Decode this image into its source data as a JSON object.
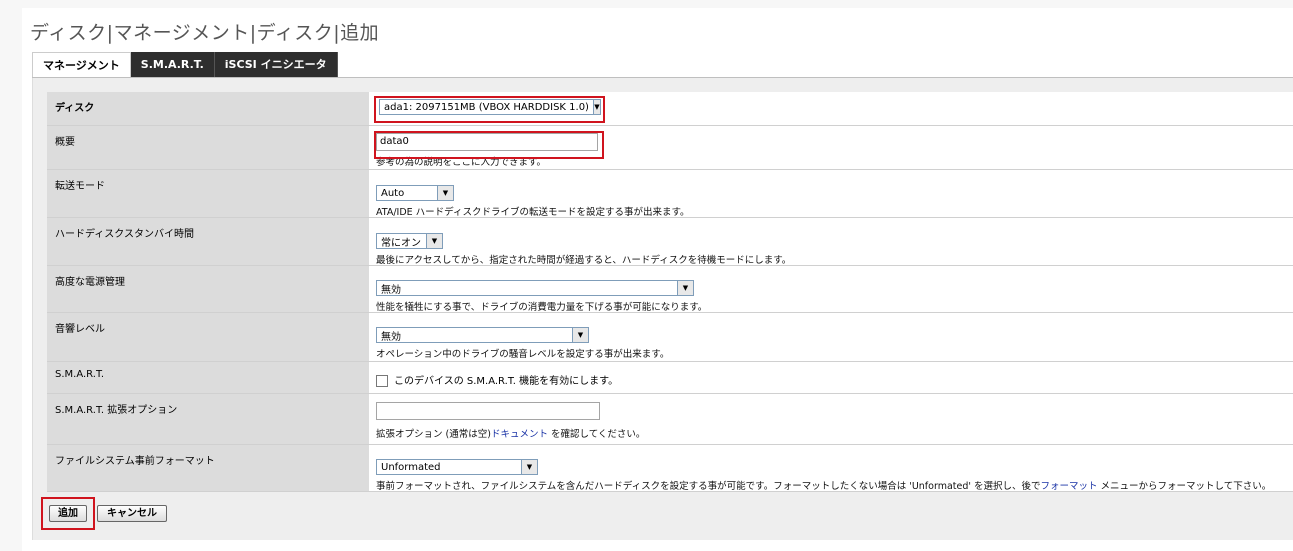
{
  "page": {
    "title": "ディスク|マネージメント|ディスク|追加"
  },
  "tabs": [
    {
      "label": "マネージメント",
      "active": true
    },
    {
      "label": "S.M.A.R.T.",
      "active": false
    },
    {
      "label": "iSCSI イニシエータ",
      "active": false
    }
  ],
  "form": {
    "disk": {
      "label": "ディスク",
      "value": "ada1: 2097151MB (VBOX HARDDISK 1.0)"
    },
    "description": {
      "label": "概要",
      "value": "data0",
      "help": "参考の為の説明をここに入力できます。"
    },
    "transfer_mode": {
      "label": "転送モード",
      "value": "Auto",
      "help": "ATA/IDE ハードディスクドライブの転送モードを設定する事が出来ます。"
    },
    "standby_time": {
      "label": "ハードディスクスタンバイ時間",
      "value": "常にオン",
      "help": "最後にアクセスしてから、指定された時間が経過すると、ハードディスクを待機モードにします。"
    },
    "power_management": {
      "label": "高度な電源管理",
      "value": "無効",
      "help": "性能を犠牲にする事で、ドライブの消費電力量を下げる事が可能になります。"
    },
    "acoustic_level": {
      "label": "音響レベル",
      "value": "無効",
      "help": "オペレーション中のドライブの騒音レベルを設定する事が出来ます。"
    },
    "smart": {
      "label": "S.M.A.R.T.",
      "checkbox_label": "このデバイスの S.M.A.R.T. 機能を有効にします。",
      "checked": false
    },
    "smart_options": {
      "label": "S.M.A.R.T. 拡張オプション",
      "value": "",
      "help_before": "拡張オプション (通常は空)",
      "help_link": "ドキュメント",
      "help_after": " を確認してください。"
    },
    "preformat": {
      "label": "ファイルシステム事前フォーマット",
      "value": "Unformated",
      "help_before": "事前フォーマットされ、ファイルシステムを含んだハードディスクを設定する事が可能です。フォーマットしたくない場合は 'Unformated' を選択し、後で",
      "help_link": "フォーマット",
      "help_after": " メニューからフォーマットして下さい。"
    }
  },
  "buttons": {
    "add": "追加",
    "cancel": "キャンセル"
  },
  "colors": {
    "highlight": "#d0141e",
    "tab_dark": "#2e2e2e",
    "label_bg": "#dcdcdc",
    "link": "#1a33a6"
  },
  "icons": {
    "dropdown": "chevron-down-icon",
    "checkbox": "checkbox-icon"
  }
}
